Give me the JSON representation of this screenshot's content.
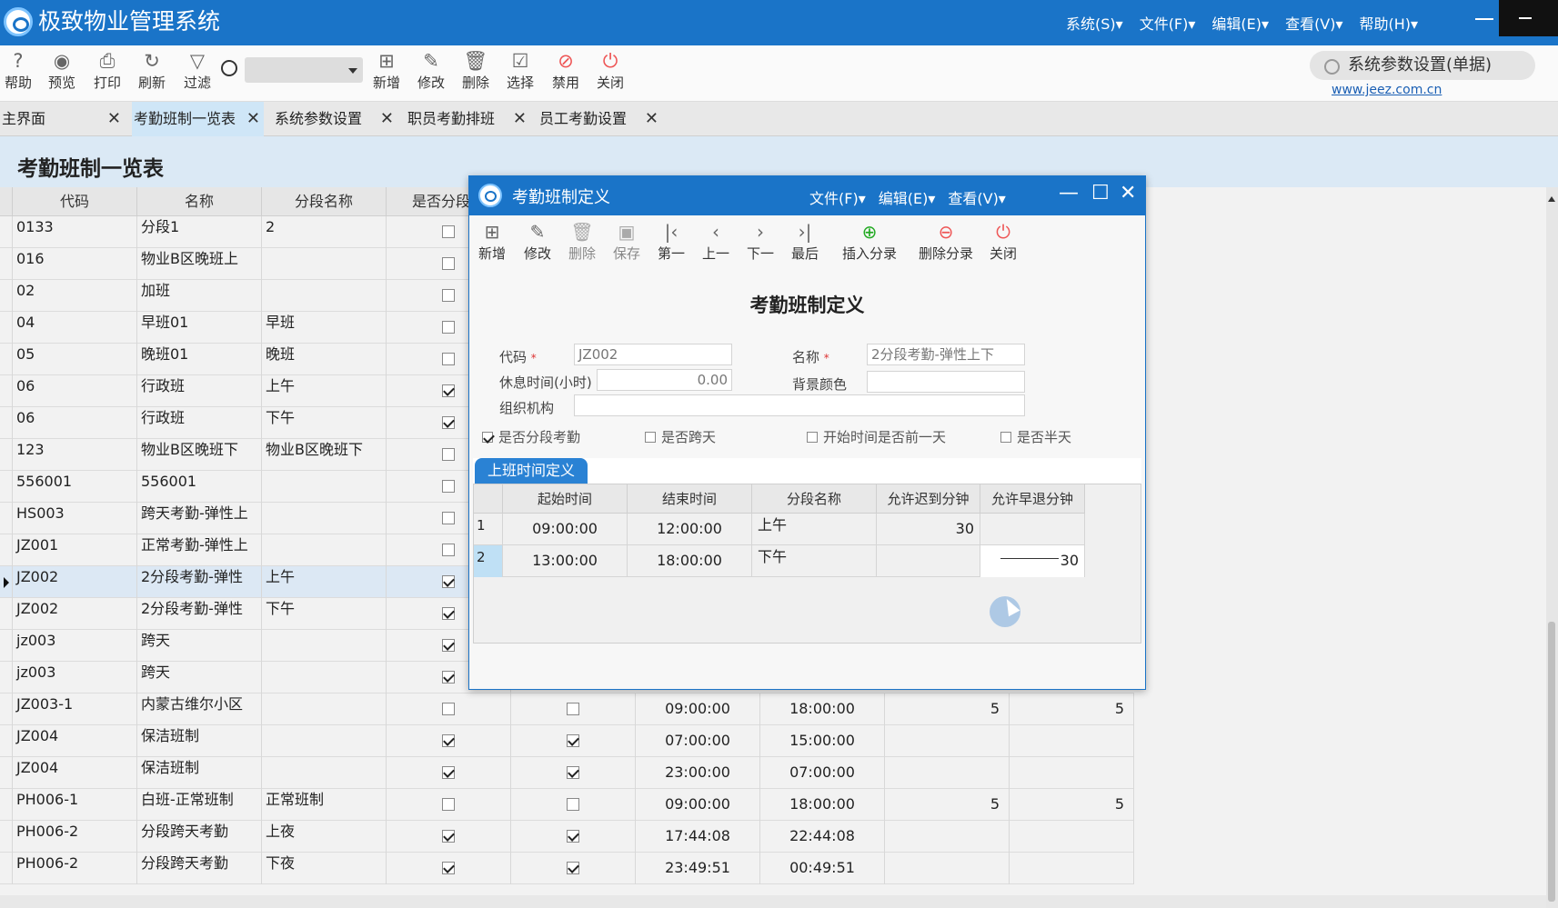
{
  "app": {
    "title": "极致物业管理系统",
    "menu": [
      "系统(S)▾",
      "文件(F)▾",
      "编辑(E)▾",
      "查看(V)▾",
      "帮助(H)▾"
    ]
  },
  "toolbar": {
    "help": "帮助",
    "preview": "预览",
    "print": "打印",
    "refresh": "刷新",
    "filter": "过滤",
    "new": "新增",
    "edit": "修改",
    "delete": "删除",
    "select": "选择",
    "disable": "禁用",
    "close": "关闭",
    "search_value": ""
  },
  "right_search": {
    "text": "系统参数设置(单据)",
    "link": "www.jeez.com.cn"
  },
  "tabs": [
    {
      "label": "主界面",
      "close": "✕"
    },
    {
      "label": "考勤班制一览表",
      "close": "✕"
    },
    {
      "label": "系统参数设置",
      "close": "✕"
    },
    {
      "label": "职员考勤排班",
      "close": "✕"
    },
    {
      "label": "员工考勤设置",
      "close": "✕"
    }
  ],
  "page": {
    "title": "考勤班制一览表"
  },
  "grid": {
    "headers": [
      "代码",
      "名称",
      "分段名称",
      "是否分段考"
    ],
    "rows": [
      {
        "code": "0133",
        "name": "分段1",
        "seg": "2",
        "segmented": false
      },
      {
        "code": "016",
        "name": "物业B区晚班上",
        "seg": "",
        "segmented": false
      },
      {
        "code": "02",
        "name": "加班",
        "seg": "",
        "segmented": false
      },
      {
        "code": "04",
        "name": "早班01",
        "seg": "早班",
        "segmented": false
      },
      {
        "code": "05",
        "name": "晚班01",
        "seg": "晚班",
        "segmented": false
      },
      {
        "code": "06",
        "name": "行政班",
        "seg": "上午",
        "segmented": true
      },
      {
        "code": "06",
        "name": "行政班",
        "seg": "下午",
        "segmented": true
      },
      {
        "code": "123",
        "name": "物业B区晚班下",
        "seg": "物业B区晚班下",
        "segmented": false
      },
      {
        "code": "556001",
        "name": "556001",
        "seg": "",
        "segmented": false
      },
      {
        "code": "HS003",
        "name": "跨天考勤-弹性上",
        "seg": "",
        "segmented": false
      },
      {
        "code": "JZ001",
        "name": "正常考勤-弹性上",
        "seg": "",
        "segmented": false
      },
      {
        "code": "JZ002",
        "name": "2分段考勤-弹性",
        "seg": "上午",
        "segmented": true
      },
      {
        "code": "JZ002",
        "name": "2分段考勤-弹性",
        "seg": "下午",
        "segmented": true
      },
      {
        "code": "jz003",
        "name": "跨天",
        "seg": "",
        "segmented": true
      },
      {
        "code": "jz003",
        "name": "跨天",
        "seg": "",
        "segmented": true
      },
      {
        "code": "JZ003-1",
        "name": "内蒙古维尔小区",
        "seg": "",
        "segmented": false,
        "cross": false,
        "start": "09:00:00",
        "end": "18:00:00",
        "late": "5",
        "early": "5"
      },
      {
        "code": "JZ004",
        "name": "保洁班制",
        "seg": "",
        "segmented": true,
        "cross": true,
        "start": "07:00:00",
        "end": "15:00:00",
        "late": "",
        "early": ""
      },
      {
        "code": "JZ004",
        "name": "保洁班制",
        "seg": "",
        "segmented": true,
        "cross": true,
        "start": "23:00:00",
        "end": "07:00:00",
        "late": "",
        "early": ""
      },
      {
        "code": "PH006-1",
        "name": "白班-正常班制",
        "seg": "正常班制",
        "segmented": false,
        "cross": false,
        "start": "09:00:00",
        "end": "18:00:00",
        "late": "5",
        "early": "5"
      },
      {
        "code": "PH006-2",
        "name": "分段跨天考勤",
        "seg": "上夜",
        "segmented": true,
        "cross": true,
        "start": "17:44:08",
        "end": "22:44:08",
        "late": "",
        "early": ""
      },
      {
        "code": "PH006-2",
        "name": "分段跨天考勤",
        "seg": "下夜",
        "segmented": true,
        "cross": true,
        "start": "23:49:51",
        "end": "00:49:51",
        "late": "",
        "early": ""
      }
    ]
  },
  "dialog": {
    "title": "考勤班制定义",
    "menu": [
      "文件(F)▾",
      "编辑(E)▾",
      "查看(V)▾"
    ],
    "controls": {
      "min": "—",
      "max": "☐",
      "close": "✕"
    },
    "toolbar": {
      "new": "新增",
      "edit": "修改",
      "delete": "删除",
      "save": "保存",
      "first": "第一",
      "prev": "上一",
      "next": "下一",
      "last": "最后",
      "insert_entry": "插入分录",
      "delete_entry": "删除分录",
      "close": "关闭"
    },
    "heading": "考勤班制定义",
    "fields": {
      "code_label": "代码",
      "code_value": "JZ002",
      "name_label": "名称",
      "name_value": "2分段考勤-弹性上下",
      "rest_label": "休息时间(小时)",
      "rest_value": "0.00",
      "bg_label": "背景颜色",
      "bg_value": "",
      "org_label": "组织机构",
      "org_value": "",
      "required_mark": "*"
    },
    "options": [
      {
        "label": "是否分段考勤",
        "checked": true
      },
      {
        "label": "是否跨天",
        "checked": false
      },
      {
        "label": "开始时间是否前一天",
        "checked": false
      },
      {
        "label": "是否半天",
        "checked": false
      }
    ],
    "tab": "上班时间定义",
    "grid_headers": [
      "起始时间",
      "结束时间",
      "分段名称",
      "允许迟到分钟",
      "允许早退分钟"
    ],
    "grid_rows": [
      {
        "no": "1",
        "start": "09:00:00",
        "end": "12:00:00",
        "seg": "上午",
        "late": "30",
        "early": ""
      },
      {
        "no": "2",
        "start": "13:00:00",
        "end": "18:00:00",
        "seg": "下午",
        "late": "",
        "early": "30"
      }
    ]
  }
}
